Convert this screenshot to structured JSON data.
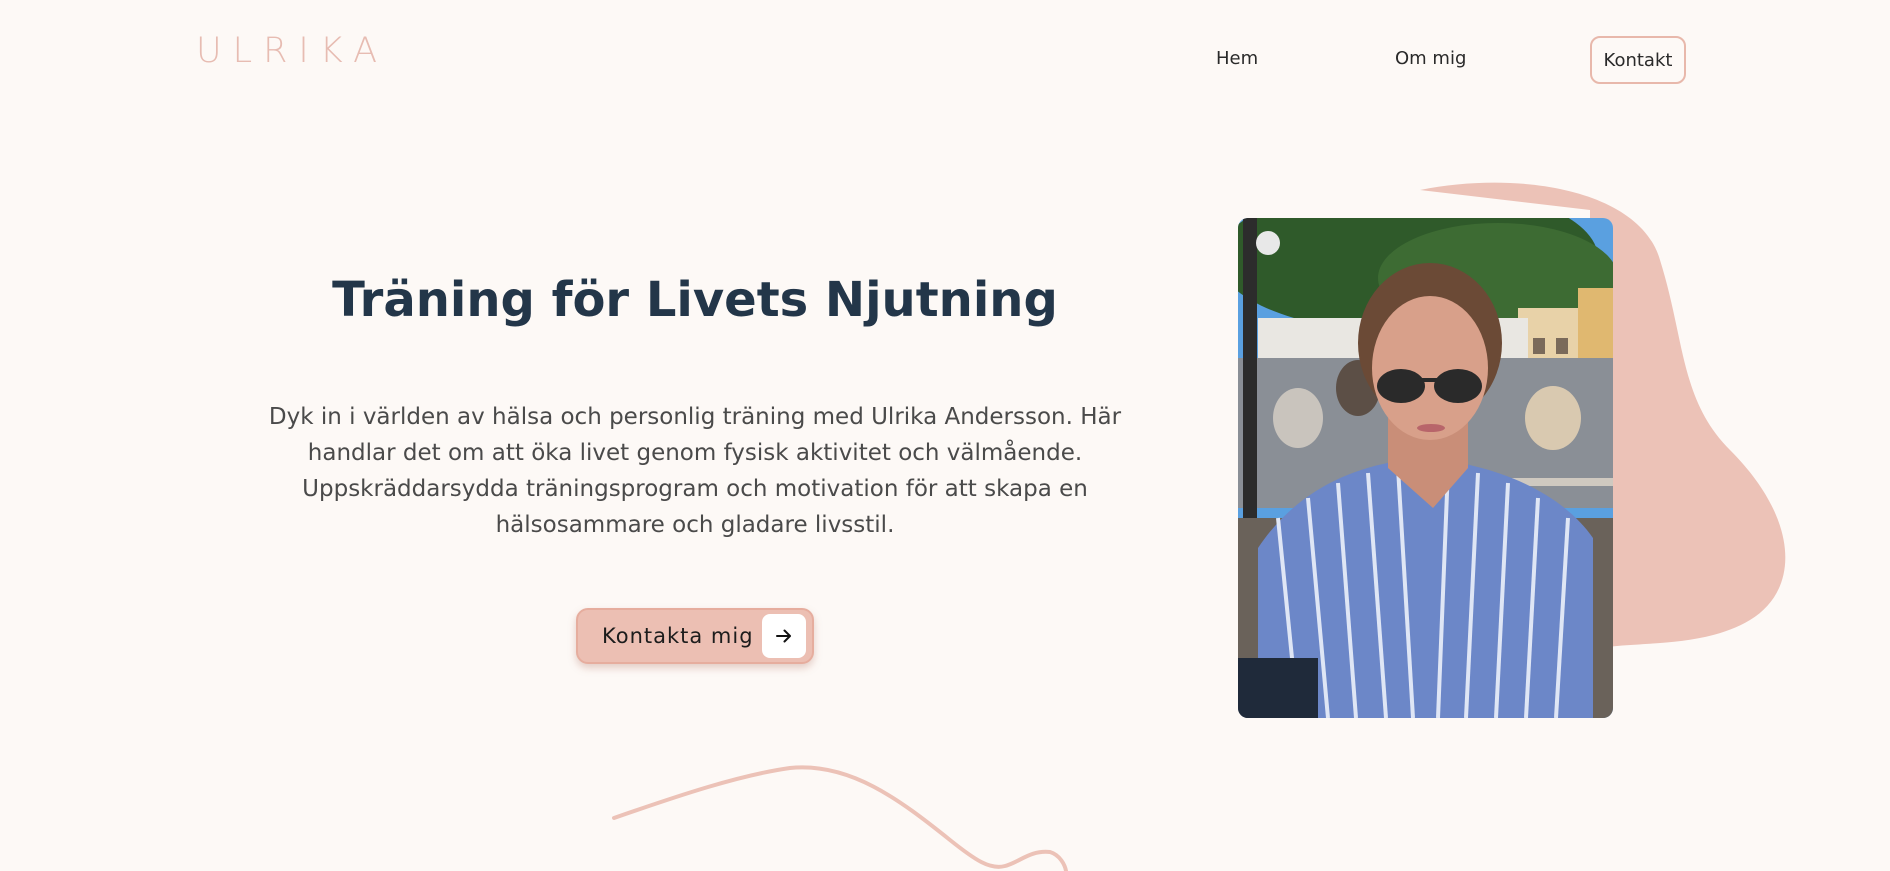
{
  "header": {
    "logo_text": "ULRIKA",
    "nav": {
      "home_label": "Hem",
      "about_label": "Om mig",
      "contact_label": "Kontakt"
    }
  },
  "hero": {
    "title": "Träning för Livets Njutning",
    "description": "Dyk in i världen av hälsa och personlig träning med Ulrika Andersson. Här handlar det om att öka livet genom fysisk aktivitet och välmående. Uppskräddarsydda träningsprogram och motivation för att skapa en hälsosammare och gladare livsstil.",
    "cta_label": "Kontakta mig",
    "cta_icon": "arrow-right-icon"
  },
  "colors": {
    "background": "#fdf9f6",
    "accent": "#ecbfb3",
    "heading": "#233649",
    "logo": "#e7bcb2"
  }
}
